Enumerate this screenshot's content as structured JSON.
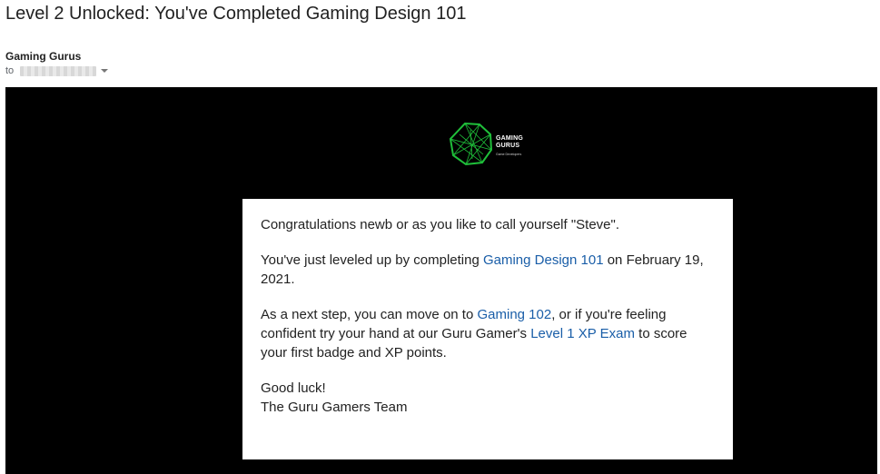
{
  "email": {
    "subject": "Level 2 Unlocked: You've Completed Gaming Design 101",
    "sender": "Gaming Gurus",
    "to_label": "to"
  },
  "logo": {
    "line1": "GAMING",
    "line2": "GURUS",
    "tagline": "Game Developers",
    "color": "#1fbf3a"
  },
  "message": {
    "greeting": "Congratulations newb or as you like to call yourself \"Steve\".",
    "p2_before": "You've just leveled up by completing ",
    "p2_link": "Gaming Design 101",
    "p2_after": " on February 19, 2021.",
    "p3_before": "As a next step, you can move on to ",
    "p3_link1": "Gaming 102",
    "p3_middle": ", or if you're feeling confident try your hand at our Guru Gamer's ",
    "p3_link2": "Level 1 XP Exam",
    "p3_after": " to score your first badge and XP points.",
    "signoff": "Good luck!",
    "signature": "The Guru Gamers Team"
  },
  "colors": {
    "link": "#1a5ea8",
    "banner_bg": "#000000"
  }
}
